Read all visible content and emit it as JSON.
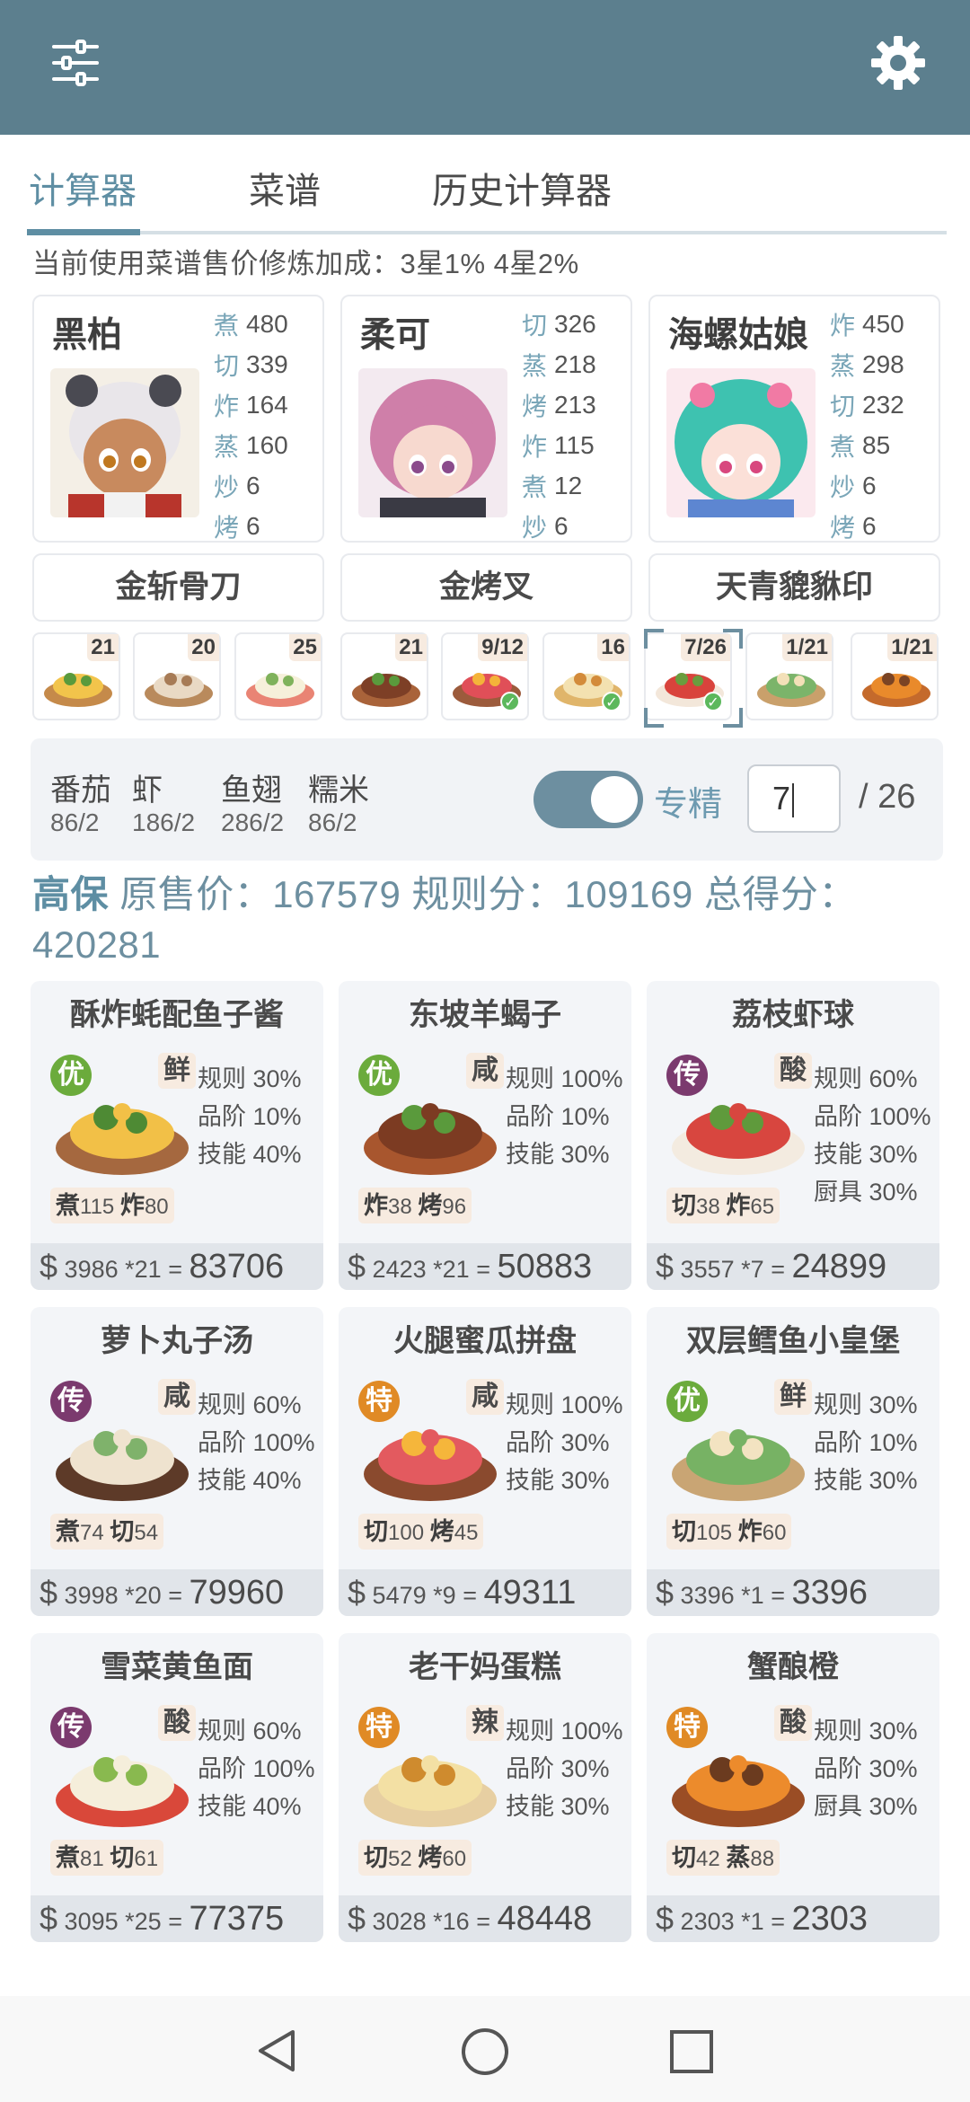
{
  "topbar": {
    "left_icon": "sliders-icon",
    "right_icon": "gear-icon",
    "color": "#5c7f8e"
  },
  "tabs": [
    {
      "label": "计算器",
      "active": true
    },
    {
      "label": "菜谱",
      "active": false
    },
    {
      "label": "历史计算器",
      "active": false
    }
  ],
  "notice": "当前使用菜谱售价修炼加成：3星1% 4星2%",
  "chefs": [
    {
      "name": "黑柏",
      "skills": [
        {
          "k": "煮",
          "v": "480"
        },
        {
          "k": "切",
          "v": "339"
        },
        {
          "k": "炸",
          "v": "164"
        },
        {
          "k": "蒸",
          "v": "160"
        },
        {
          "k": "炒",
          "v": "6"
        },
        {
          "k": "烤",
          "v": "6"
        }
      ]
    },
    {
      "name": "柔可",
      "skills": [
        {
          "k": "切",
          "v": "326"
        },
        {
          "k": "蒸",
          "v": "218"
        },
        {
          "k": "烤",
          "v": "213"
        },
        {
          "k": "炸",
          "v": "115"
        },
        {
          "k": "煮",
          "v": "12"
        },
        {
          "k": "炒",
          "v": "6"
        }
      ]
    },
    {
      "name": "海螺姑娘",
      "skills": [
        {
          "k": "炸",
          "v": "450"
        },
        {
          "k": "蒸",
          "v": "298"
        },
        {
          "k": "切",
          "v": "232"
        },
        {
          "k": "煮",
          "v": "85"
        },
        {
          "k": "炒",
          "v": "6"
        },
        {
          "k": "烤",
          "v": "6"
        }
      ]
    }
  ],
  "equipment": [
    "金斩骨刀",
    "金烤叉",
    "天青貔貅印"
  ],
  "dish_slots": [
    {
      "count": "21",
      "checked": false
    },
    {
      "count": "20",
      "checked": false
    },
    {
      "count": "25",
      "checked": false
    },
    {
      "count": "21",
      "checked": false
    },
    {
      "count": "9/12",
      "checked": true
    },
    {
      "count": "16",
      "checked": true
    },
    {
      "count": "7/26",
      "checked": true,
      "selected": true
    },
    {
      "count": "1/21",
      "checked": false
    },
    {
      "count": "1/21",
      "checked": false
    }
  ],
  "ingredients": [
    {
      "name": "番茄",
      "qty": "86/2"
    },
    {
      "name": "虾",
      "qty": "186/2"
    },
    {
      "name": "鱼翅",
      "qty": "286/2"
    },
    {
      "name": "糯米",
      "qty": "86/2"
    }
  ],
  "specialize": {
    "label": "专精",
    "on": true,
    "value": "7",
    "total": "/ 26"
  },
  "summary": {
    "tier": "高保",
    "orig_label": "原售价：",
    "orig_value": "167579",
    "rule_label": "规则分：",
    "rule_value": "109169",
    "total_label": "总得分：",
    "total_value": "420281"
  },
  "dishes": [
    {
      "name": "酥炸蚝配鱼子酱",
      "grade": "优",
      "grade_color": "#6bab3c",
      "flavor": "鲜",
      "bonus": [
        "规则 30%",
        "品阶 10%",
        "技能 40%"
      ],
      "need": [
        {
          "k": "煮",
          "v": "115"
        },
        {
          "k": "炸",
          "v": "80"
        }
      ],
      "price": "3986",
      "mult": "*21",
      "eq": "=",
      "result": "83706"
    },
    {
      "name": "东坡羊蝎子",
      "grade": "优",
      "grade_color": "#6bab3c",
      "flavor": "咸",
      "bonus": [
        "规则 100%",
        "品阶 10%",
        "技能 30%"
      ],
      "need": [
        {
          "k": "炸",
          "v": "38"
        },
        {
          "k": "烤",
          "v": "96"
        }
      ],
      "price": "2423",
      "mult": "*21",
      "eq": "=",
      "result": "50883"
    },
    {
      "name": "荔枝虾球",
      "grade": "传",
      "grade_color": "#7b3a6e",
      "flavor": "酸",
      "bonus": [
        "规则 60%",
        "品阶 100%",
        "技能 30%",
        "厨具 30%"
      ],
      "need": [
        {
          "k": "切",
          "v": "38"
        },
        {
          "k": "炸",
          "v": "65"
        }
      ],
      "price": "3557",
      "mult": "*7",
      "eq": "=",
      "result": "24899"
    },
    {
      "name": "萝卜丸子汤",
      "grade": "传",
      "grade_color": "#7b3a6e",
      "flavor": "咸",
      "bonus": [
        "规则 60%",
        "品阶 100%",
        "技能 40%"
      ],
      "need": [
        {
          "k": "煮",
          "v": "74"
        },
        {
          "k": "切",
          "v": "54"
        }
      ],
      "price": "3998",
      "mult": "*20",
      "eq": "=",
      "result": "79960"
    },
    {
      "name": "火腿蜜瓜拼盘",
      "grade": "特",
      "grade_color": "#e08a25",
      "flavor": "咸",
      "bonus": [
        "规则 100%",
        "品阶 30%",
        "技能 30%"
      ],
      "need": [
        {
          "k": "切",
          "v": "100"
        },
        {
          "k": "烤",
          "v": "45"
        }
      ],
      "price": "5479",
      "mult": "*9",
      "eq": "=",
      "result": "49311"
    },
    {
      "name": "双层鳕鱼小皇堡",
      "grade": "优",
      "grade_color": "#6bab3c",
      "flavor": "鲜",
      "bonus": [
        "规则 30%",
        "品阶 10%",
        "技能 30%"
      ],
      "need": [
        {
          "k": "切",
          "v": "105"
        },
        {
          "k": "炸",
          "v": "60"
        }
      ],
      "price": "3396",
      "mult": "*1",
      "eq": "=",
      "result": "3396"
    },
    {
      "name": "雪菜黄鱼面",
      "grade": "传",
      "grade_color": "#7b3a6e",
      "flavor": "酸",
      "bonus": [
        "规则 60%",
        "品阶 100%",
        "技能 40%"
      ],
      "need": [
        {
          "k": "煮",
          "v": "81"
        },
        {
          "k": "切",
          "v": "61"
        }
      ],
      "price": "3095",
      "mult": "*25",
      "eq": "=",
      "result": "77375"
    },
    {
      "name": "老干妈蛋糕",
      "grade": "特",
      "grade_color": "#e08a25",
      "flavor": "辣",
      "bonus": [
        "规则 100%",
        "品阶 30%",
        "技能 30%"
      ],
      "need": [
        {
          "k": "切",
          "v": "52"
        },
        {
          "k": "烤",
          "v": "60"
        }
      ],
      "price": "3028",
      "mult": "*16",
      "eq": "=",
      "result": "48448"
    },
    {
      "name": "蟹酿橙",
      "grade": "特",
      "grade_color": "#e08a25",
      "flavor": "酸",
      "bonus": [
        "规则 30%",
        "品阶 30%",
        "厨具 30%"
      ],
      "need": [
        {
          "k": "切",
          "v": "42"
        },
        {
          "k": "蒸",
          "v": "88"
        }
      ],
      "price": "2303",
      "mult": "*1",
      "eq": "=",
      "result": "2303"
    }
  ],
  "navbar": {
    "icons": [
      "back-triangle-icon",
      "home-circle-icon",
      "recents-square-icon"
    ]
  }
}
